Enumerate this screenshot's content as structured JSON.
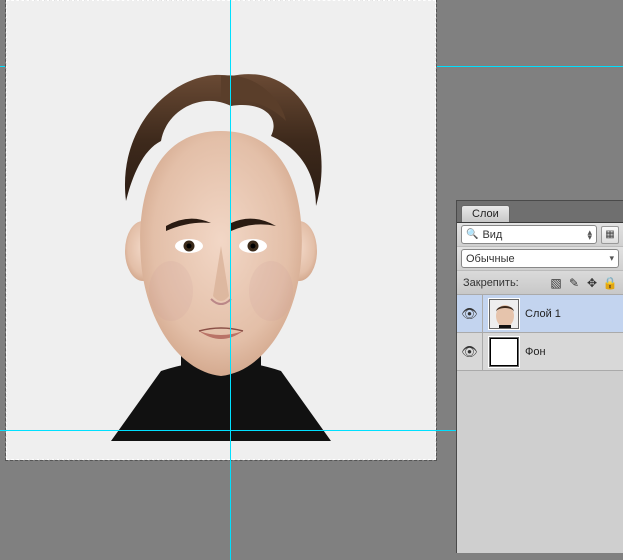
{
  "canvas": {
    "guides": {
      "v_main": 224,
      "h1": 66,
      "h2": 430
    },
    "guide_h_extended": 66
  },
  "panel": {
    "tab_label": "Слои",
    "filter_label": "Вид",
    "blend_mode": "Обычные",
    "lock_label": "Закрепить:",
    "layers": [
      {
        "name": "Слой 1",
        "type": "image",
        "visible": true,
        "selected": true
      },
      {
        "name": "Фон",
        "type": "solid",
        "visible": true,
        "selected": false
      }
    ]
  }
}
